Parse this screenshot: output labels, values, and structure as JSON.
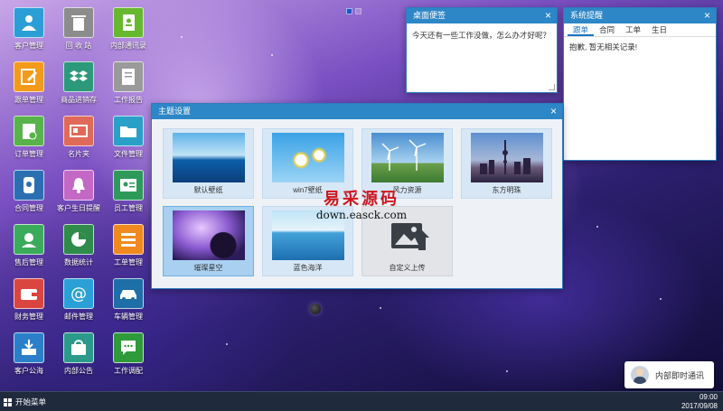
{
  "desktop": {
    "icons": [
      {
        "label": "客户管理",
        "icon": "people-icon",
        "color": "#2b9ed6"
      },
      {
        "label": "回 收 站",
        "icon": "trash-icon",
        "color": "#8c8c8c"
      },
      {
        "label": "内部通讯录",
        "icon": "address-book-icon",
        "color": "#66b82e"
      },
      {
        "label": "跟单管理",
        "icon": "edit-icon",
        "color": "#f39a1b"
      },
      {
        "label": "商品进销存",
        "icon": "dropbox-icon",
        "color": "#2c9a7a"
      },
      {
        "label": "工作报告",
        "icon": "report-icon",
        "color": "#9a9a9a"
      },
      {
        "label": "订单管理",
        "icon": "clipboard-icon",
        "color": "#59b34b"
      },
      {
        "label": "名片夹",
        "icon": "card-icon",
        "color": "#e06a5a"
      },
      {
        "label": "文件管理",
        "icon": "folder-icon",
        "color": "#2aa0c9"
      },
      {
        "label": "合同管理",
        "icon": "contract-icon",
        "color": "#2b6fb3"
      },
      {
        "label": "客户生日提醒",
        "icon": "bell-icon",
        "color": "#c468c6"
      },
      {
        "label": "员工管理",
        "icon": "employee-icon",
        "color": "#2e9a5a"
      },
      {
        "label": "售后管理",
        "icon": "support-icon",
        "color": "#3aab5a"
      },
      {
        "label": "数据统计",
        "icon": "pie-chart-icon",
        "color": "#2e8b4a"
      },
      {
        "label": "工单管理",
        "icon": "list-icon",
        "color": "#f08a1e"
      },
      {
        "label": "财务管理",
        "icon": "wallet-icon",
        "color": "#d9463f"
      },
      {
        "label": "邮件管理",
        "icon": "at-icon",
        "color": "#2aa0d6"
      },
      {
        "label": "车辆管理",
        "icon": "car-icon",
        "color": "#1e6ea8"
      },
      {
        "label": "客户公海",
        "icon": "download-icon",
        "color": "#2b7fc9"
      },
      {
        "label": "内部公告",
        "icon": "bag-icon",
        "color": "#2b9a8a"
      },
      {
        "label": "工作调配",
        "icon": "chat-icon",
        "color": "#2e9a3a"
      }
    ]
  },
  "note_window": {
    "title": "桌面便签",
    "text": "今天还有一些工作没做，怎么办才好呢？",
    "close": "×"
  },
  "remind_window": {
    "title": "系统提醒",
    "close": "×",
    "tabs": [
      "跟单",
      "合同",
      "工单",
      "生日"
    ],
    "active_tab": 0,
    "message": "抱歉, 暂无相关记录!"
  },
  "theme_window": {
    "title": "主题设置",
    "close": "×",
    "themes": [
      {
        "caption": "默认壁纸",
        "selected": false
      },
      {
        "caption": "win7壁纸",
        "selected": false
      },
      {
        "caption": "风力资源",
        "selected": false
      },
      {
        "caption": "东方明珠",
        "selected": false
      },
      {
        "caption": "璀璨星空",
        "selected": true
      },
      {
        "caption": "蓝色海洋",
        "selected": false
      },
      {
        "caption": "自定义上传",
        "selected": false
      }
    ]
  },
  "watermark": {
    "line1": "易采源码",
    "line2": "down.easck.com"
  },
  "chat_button": {
    "label": "内部即时通讯"
  },
  "taskbar": {
    "start_label": "开始菜单",
    "time": "09:00",
    "date": "2017/09/08"
  }
}
